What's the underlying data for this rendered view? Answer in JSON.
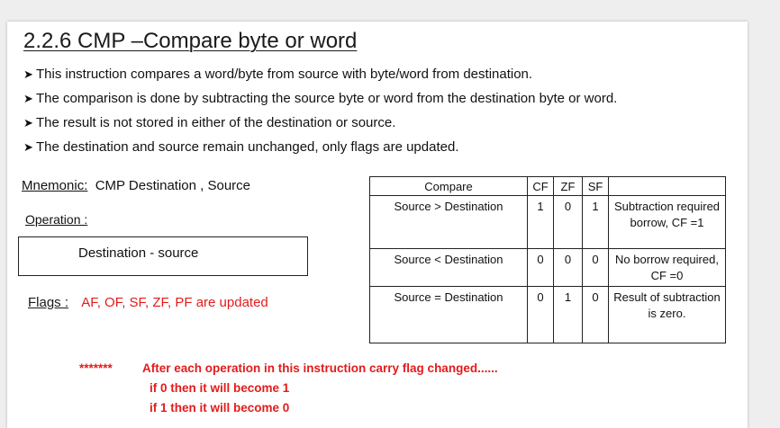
{
  "title": "2.2.6  CMP –Compare byte or word",
  "bullets": [
    "This instruction compares a word/byte from source with byte/word from destination.",
    "The comparison is done by subtracting the source byte or word from the destination byte or word.",
    "The result is not stored in either of the destination or source.",
    "The destination and source remain unchanged, only flags are updated."
  ],
  "mnemonic": {
    "label": "Mnemonic:",
    "value": "CMP  Destination , Source"
  },
  "operation": {
    "label": "Operation :",
    "value": "Destination - source"
  },
  "flags": {
    "label": "Flags :",
    "value": "AF, OF, SF, ZF, PF are updated"
  },
  "table": {
    "headers": [
      "Compare",
      "CF",
      "ZF",
      "SF",
      ""
    ],
    "rows": [
      {
        "compare": "Source > Destination",
        "cf": "1",
        "zf": "0",
        "sf": "1",
        "note": "Subtraction required borrow, CF =1"
      },
      {
        "compare": "Source < Destination",
        "cf": "0",
        "zf": "0",
        "sf": "0",
        "note": "No borrow required, CF =0"
      },
      {
        "compare": "Source = Destination",
        "cf": "0",
        "zf": "1",
        "sf": "0",
        "note": "Result of subtraction is zero."
      }
    ]
  },
  "note": {
    "stars": "*******",
    "line1": "After each operation in this instruction carry flag changed......",
    "line2": "if 0 then it will become 1",
    "line3": "if 1 then it will become 0"
  },
  "colors": {
    "accent_red": "#e31b1b",
    "text": "#1a1a1a"
  }
}
